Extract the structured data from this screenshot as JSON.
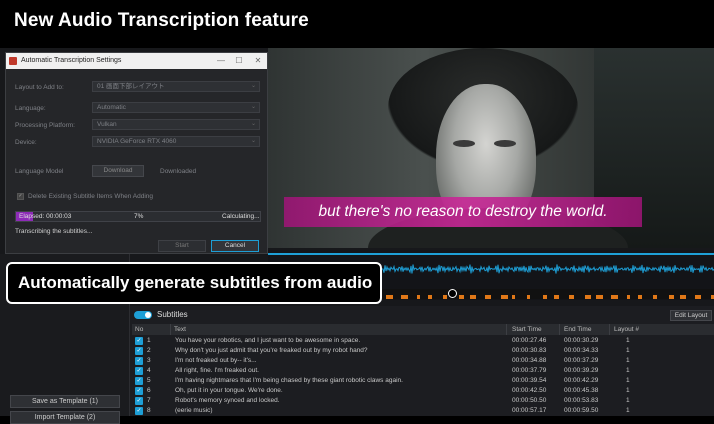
{
  "banner": {
    "title": "New Audio Transcription feature"
  },
  "dialog": {
    "title": "Automatic Transcription Settings",
    "window_controls": {
      "minimize": "—",
      "maximize": "☐",
      "close": "✕"
    },
    "layout_label": "Layout to Add to:",
    "layout_value": "01 画面下部レイアウト",
    "language_label": "Language:",
    "language_value": "Automatic",
    "platform_label": "Processing Platform:",
    "platform_value": "Vulkan",
    "device_label": "Device:",
    "device_value": "NVIDIA GeForce RTX 4060",
    "model_label": "Language Model",
    "download_button": "Download",
    "model_status": "Downloaded",
    "delete_existing_label": "Delete Existing Subtitle Items When Adding",
    "delete_existing_checked": true,
    "elapsed": "Elapsed: 00:00:03",
    "progress_percent": "7%",
    "progress_fraction": 0.07,
    "progress_status": "Calculating...",
    "status_text": "Transcribing the subtitles...",
    "start_button": "Start",
    "cancel_button": "Cancel"
  },
  "preview": {
    "subtitle": "but there's no reason to destroy the world."
  },
  "callout": {
    "text": "Automatically generate subtitles from audio"
  },
  "left_panel": {
    "save_template_button": "Save as Template (1)",
    "import_template_button": "Import Template (2)"
  },
  "subtitles_track": {
    "title": "Subtitles",
    "edit_layout_button": "Edit Layout",
    "columns": [
      "No",
      "Text",
      "Start Time",
      "End Time",
      "Layout #"
    ],
    "rows": [
      {
        "no": "1",
        "text": "You have your robotics, and I just want to be awesome in space.",
        "start": "00:00:27.46",
        "end": "00:00:30.29",
        "layout": "1"
      },
      {
        "no": "2",
        "text": "Why don't you just admit that you're freaked out by my robot hand?",
        "start": "00:00:30.83",
        "end": "00:00:34.33",
        "layout": "1"
      },
      {
        "no": "3",
        "text": "I'm not freaked out by-- it's...",
        "start": "00:00:34.88",
        "end": "00:00:37.29",
        "layout": "1"
      },
      {
        "no": "4",
        "text": "All right, fine. I'm freaked out.",
        "start": "00:00:37.79",
        "end": "00:00:39.29",
        "layout": "1"
      },
      {
        "no": "5",
        "text": "I'm having nightmares that I'm being chased by these giant robotic claws again.",
        "start": "00:00:39.54",
        "end": "00:00:42.29",
        "layout": "1"
      },
      {
        "no": "6",
        "text": "Oh, put it in your tongue. We're done.",
        "start": "00:00:42.50",
        "end": "00:00:45.38",
        "layout": "1"
      },
      {
        "no": "7",
        "text": "Robot's memory synced and locked.",
        "start": "00:00:50.50",
        "end": "00:00:53.83",
        "layout": "1"
      },
      {
        "no": "8",
        "text": "(eerie music)",
        "start": "00:00:57.17",
        "end": "00:00:59.50",
        "layout": "1"
      }
    ]
  },
  "colors": {
    "accent": "#1e9fd6",
    "progress": "#8e2bb8",
    "subtitle_bg": "#b8208e",
    "marker": "#e07818"
  }
}
